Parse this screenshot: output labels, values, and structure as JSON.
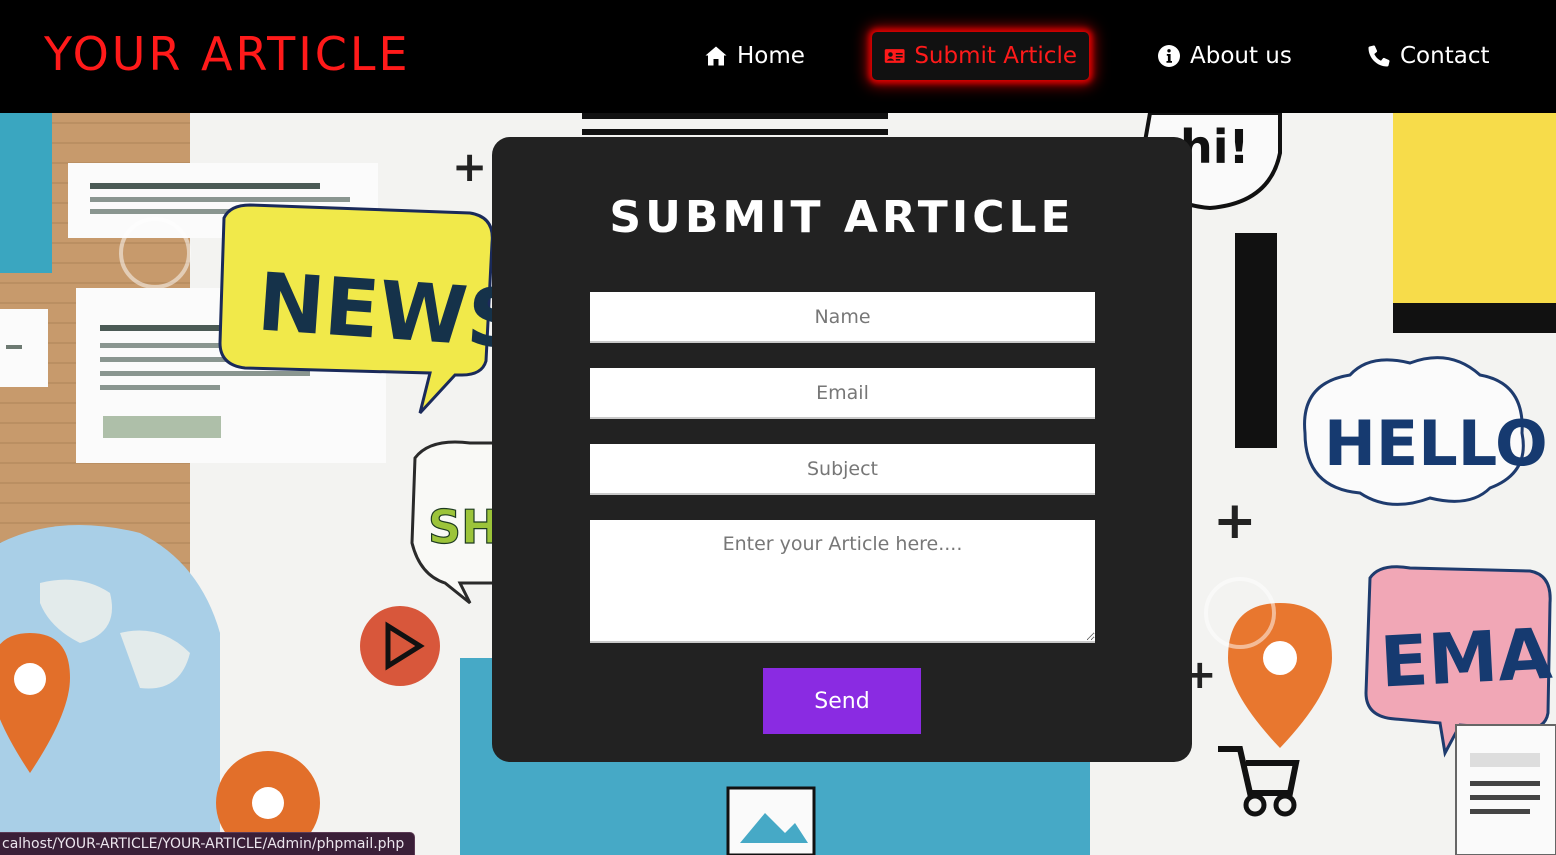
{
  "header": {
    "logo": "YOUR ARTICLE",
    "nav": [
      {
        "label": "Home",
        "icon": "home-icon"
      },
      {
        "label": "Submit Article",
        "icon": "id-card-icon",
        "active": true
      },
      {
        "label": "About us",
        "icon": "info-circle-icon"
      },
      {
        "label": "Contact",
        "icon": "phone-icon"
      }
    ]
  },
  "background_labels": {
    "news": "NEWS",
    "hello": "HELLO",
    "email": "EMAIL",
    "hi": "hi!",
    "share": "SH"
  },
  "form": {
    "title": "SUBMIT ARTICLE",
    "name_placeholder": "Name",
    "email_placeholder": "Email",
    "subject_placeholder": "Subject",
    "article_placeholder": "Enter your Article here....",
    "send_label": "Send"
  },
  "status_bar": {
    "url": "calhost/YOUR-ARTICLE/YOUR-ARTICLE/Admin/phpmail.php"
  },
  "colors": {
    "accent_red": "#ff1a1a",
    "card_bg": "#222222",
    "button_purple": "#8a2be2"
  }
}
